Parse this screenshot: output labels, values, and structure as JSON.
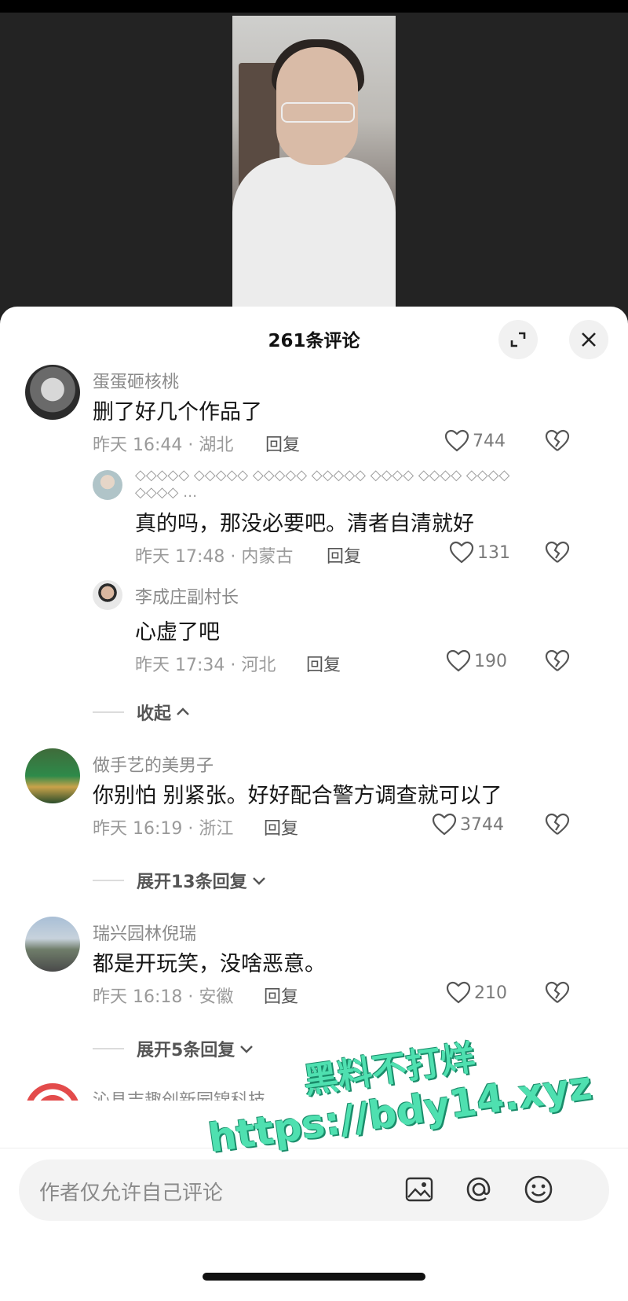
{
  "sheet": {
    "title": "261条评论"
  },
  "comments": [
    {
      "username": "蛋蛋砸核桃",
      "text": "删了好几个作品了",
      "meta": "昨天 16:44 · 湖北",
      "reply": "回复",
      "likes": "744"
    },
    {
      "username": "◇◇◇◇◇ ◇◇◇◇◇ ◇◇◇◇◇ ◇◇◇◇◇ ◇◇◇◇ ◇◇◇◇ ◇◇◇◇ ◇◇◇◇ …",
      "text": "真的吗，那没必要吧。清者自清就好",
      "meta": "昨天 17:48 · 内蒙古",
      "reply": "回复",
      "likes": "131"
    },
    {
      "username": "李成庄副村长",
      "text": "心虚了吧",
      "meta": "昨天 17:34 · 河北",
      "reply": "回复",
      "likes": "190"
    },
    {
      "username": "做手艺的美男子",
      "text": "你别怕 别紧张。好好配合警方调查就可以了",
      "meta": "昨天 16:19 · 浙江",
      "reply": "回复",
      "likes": "3744"
    },
    {
      "username": "瑞兴园林倪瑞",
      "text": "都是开玩笑，没啥恶意。",
      "meta": "昨天 16:18 · 安徽",
      "reply": "回复",
      "likes": "210"
    },
    {
      "username": "沁县吉趣创新园锦科技"
    }
  ],
  "threads": {
    "collapse": "收起",
    "expand_1": "展开13条回复",
    "expand_2": "展开5条回复"
  },
  "input": {
    "placeholder": "作者仅允许自己评论"
  },
  "watermark": {
    "line1": "黑料不打烊",
    "line2": "https://bdy14.xyz"
  }
}
